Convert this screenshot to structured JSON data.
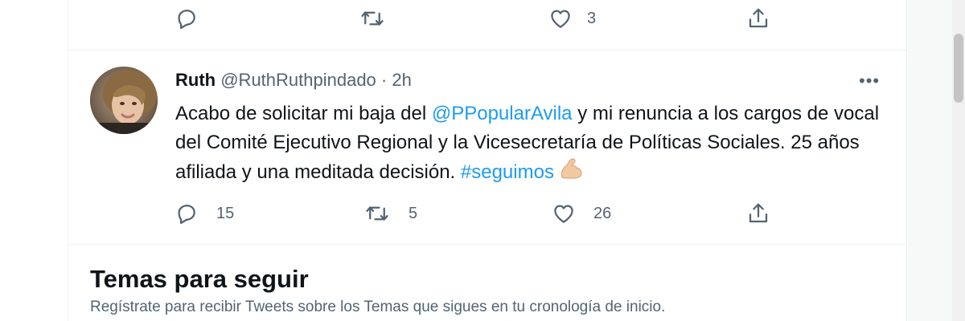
{
  "colors": {
    "text": "#0f1419",
    "secondary": "#536471",
    "link": "#1d9bf0",
    "divider": "#eff3f4"
  },
  "previous_tweet": {
    "actions": {
      "reply": {
        "icon": "reply-icon",
        "count": ""
      },
      "retweet": {
        "icon": "retweet-icon",
        "count": ""
      },
      "like": {
        "icon": "heart-icon",
        "count": "3"
      },
      "share": {
        "icon": "share-icon"
      }
    }
  },
  "tweet": {
    "name": "Ruth",
    "handle": "@RuthRuthpindado",
    "separator": "·",
    "time": "2h",
    "more": "•••",
    "text_part1": "Acabo de solicitar mi baja del ",
    "mention": "@PPopularAvila",
    "text_part2": " y mi renuncia a los cargos de vocal del Comité Ejecutivo Regional y la Vicesecretaría de Políticas Sociales. 25 años afiliada y una meditada decisión. ",
    "hashtag": "#seguimos",
    "emoji": "flexed-biceps-emoji",
    "actions": {
      "reply": {
        "icon": "reply-icon",
        "count": "15"
      },
      "retweet": {
        "icon": "retweet-icon",
        "count": "5"
      },
      "like": {
        "icon": "heart-icon",
        "count": "26"
      },
      "share": {
        "icon": "share-icon"
      }
    }
  },
  "topics": {
    "title": "Temas para seguir",
    "description": "Regístrate para recibir Tweets sobre los Temas que sigues en tu cronología de inicio."
  }
}
